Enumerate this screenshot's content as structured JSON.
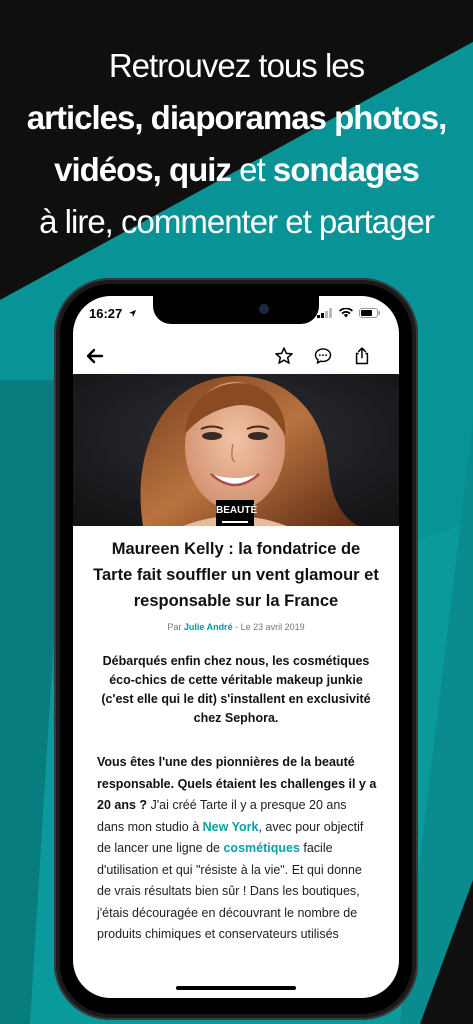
{
  "promo": {
    "line1": "Retrouvez tous les",
    "line2": "articles, diaporamas photos,",
    "line3_part1": "vidéos, quiz",
    "line3_part2": " et ",
    "line3_part3": "sondages",
    "line4": "à lire, commenter et partager"
  },
  "status": {
    "time": "16:27"
  },
  "article": {
    "category": "BEAUTÉ",
    "title": "Maureen Kelly : la fondatrice de Tarte fait souffler un vent glamour et responsable sur la France",
    "byline_prefix": "Par ",
    "author": "Julie André",
    "date": " - Le 23 avril 2019",
    "chapo": "Débarqués enfin chez nous, les cosmétiques éco-chics de cette véritable makeup junkie (c'est elle qui le dit) s'installent en exclusivité chez Sephora.",
    "body_bold": "Vous êtes l'une des pionnières de la beauté responsable. Quels étaient les challenges il y a 20 ans ?",
    "body_1": " J'ai créé Tarte il y a presque 20 ans dans mon studio à ",
    "link_1": "New York",
    "body_2": ", avec pour objectif de lancer une ligne de ",
    "link_2": "cosmétiques",
    "body_3": " facile d'utilisation et qui \"résiste à la vie\". Et qui donne de vrais résultats bien sûr ! Dans les boutiques, j'étais découragée en découvrant le nombre de produits chimiques et conservateurs utilisés"
  },
  "icons": [
    "back-arrow-icon",
    "star-icon",
    "comment-icon",
    "share-icon",
    "cellular-icon",
    "wifi-icon",
    "battery-icon",
    "location-arrow-icon"
  ],
  "colors": {
    "teal": "#0a9a9c",
    "link": "#0aa0a8",
    "background": "#0f0f0f"
  }
}
